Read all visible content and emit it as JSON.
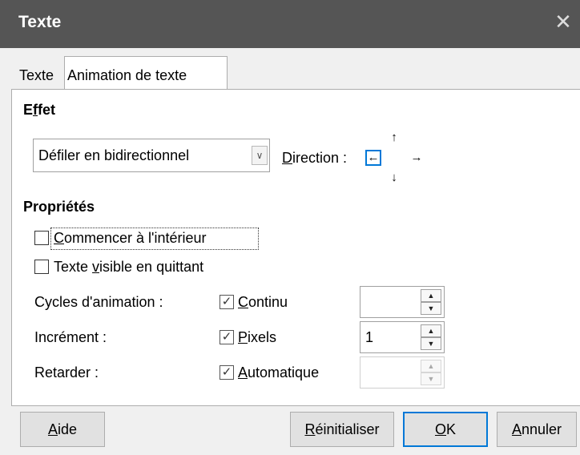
{
  "window": {
    "title": "Texte",
    "close_glyph": "✕"
  },
  "tabs": [
    {
      "label": "Texte",
      "active": false
    },
    {
      "label": "Animation de texte",
      "active": true
    }
  ],
  "effect": {
    "heading_pre": "E",
    "heading_ul": "f",
    "heading_post": "fet",
    "select_value": "Défiler en bidirectionnel",
    "direction_pre": "",
    "direction_ul": "D",
    "direction_post": "irection :",
    "arrows": {
      "up": "↑",
      "left": "←",
      "right": "→",
      "down": "↓"
    },
    "selected_direction": "left"
  },
  "properties": {
    "heading": "Propriétés",
    "start_inside": {
      "pre": "",
      "ul": "C",
      "post": "ommencer à l'intérieur",
      "checked": false
    },
    "visible_on_exit": {
      "pre": "Texte ",
      "ul": "v",
      "post": "isible en quittant",
      "checked": false
    },
    "cycles": {
      "label": "Cycles d'animation :",
      "check_pre": "",
      "check_ul": "C",
      "check_post": "ontinu",
      "checked": true,
      "value": ""
    },
    "increment": {
      "label": "Incrément :",
      "check_pre": "",
      "check_ul": "P",
      "check_post": "ixels",
      "checked": true,
      "value": "1"
    },
    "delay": {
      "label": "Retarder :",
      "check_pre": "",
      "check_ul": "A",
      "check_post": "utomatique",
      "checked": true,
      "value": ""
    }
  },
  "buttons": {
    "help": {
      "ul": "A",
      "post": "ide"
    },
    "reset": {
      "ul": "R",
      "post": "éinitialiser"
    },
    "ok": {
      "ul": "O",
      "post": "K"
    },
    "cancel": {
      "ul": "A",
      "post": "nnuler"
    }
  },
  "icons": {
    "check": "✓",
    "spin_up": "▲",
    "spin_down": "▼",
    "dropdown": "∨"
  }
}
